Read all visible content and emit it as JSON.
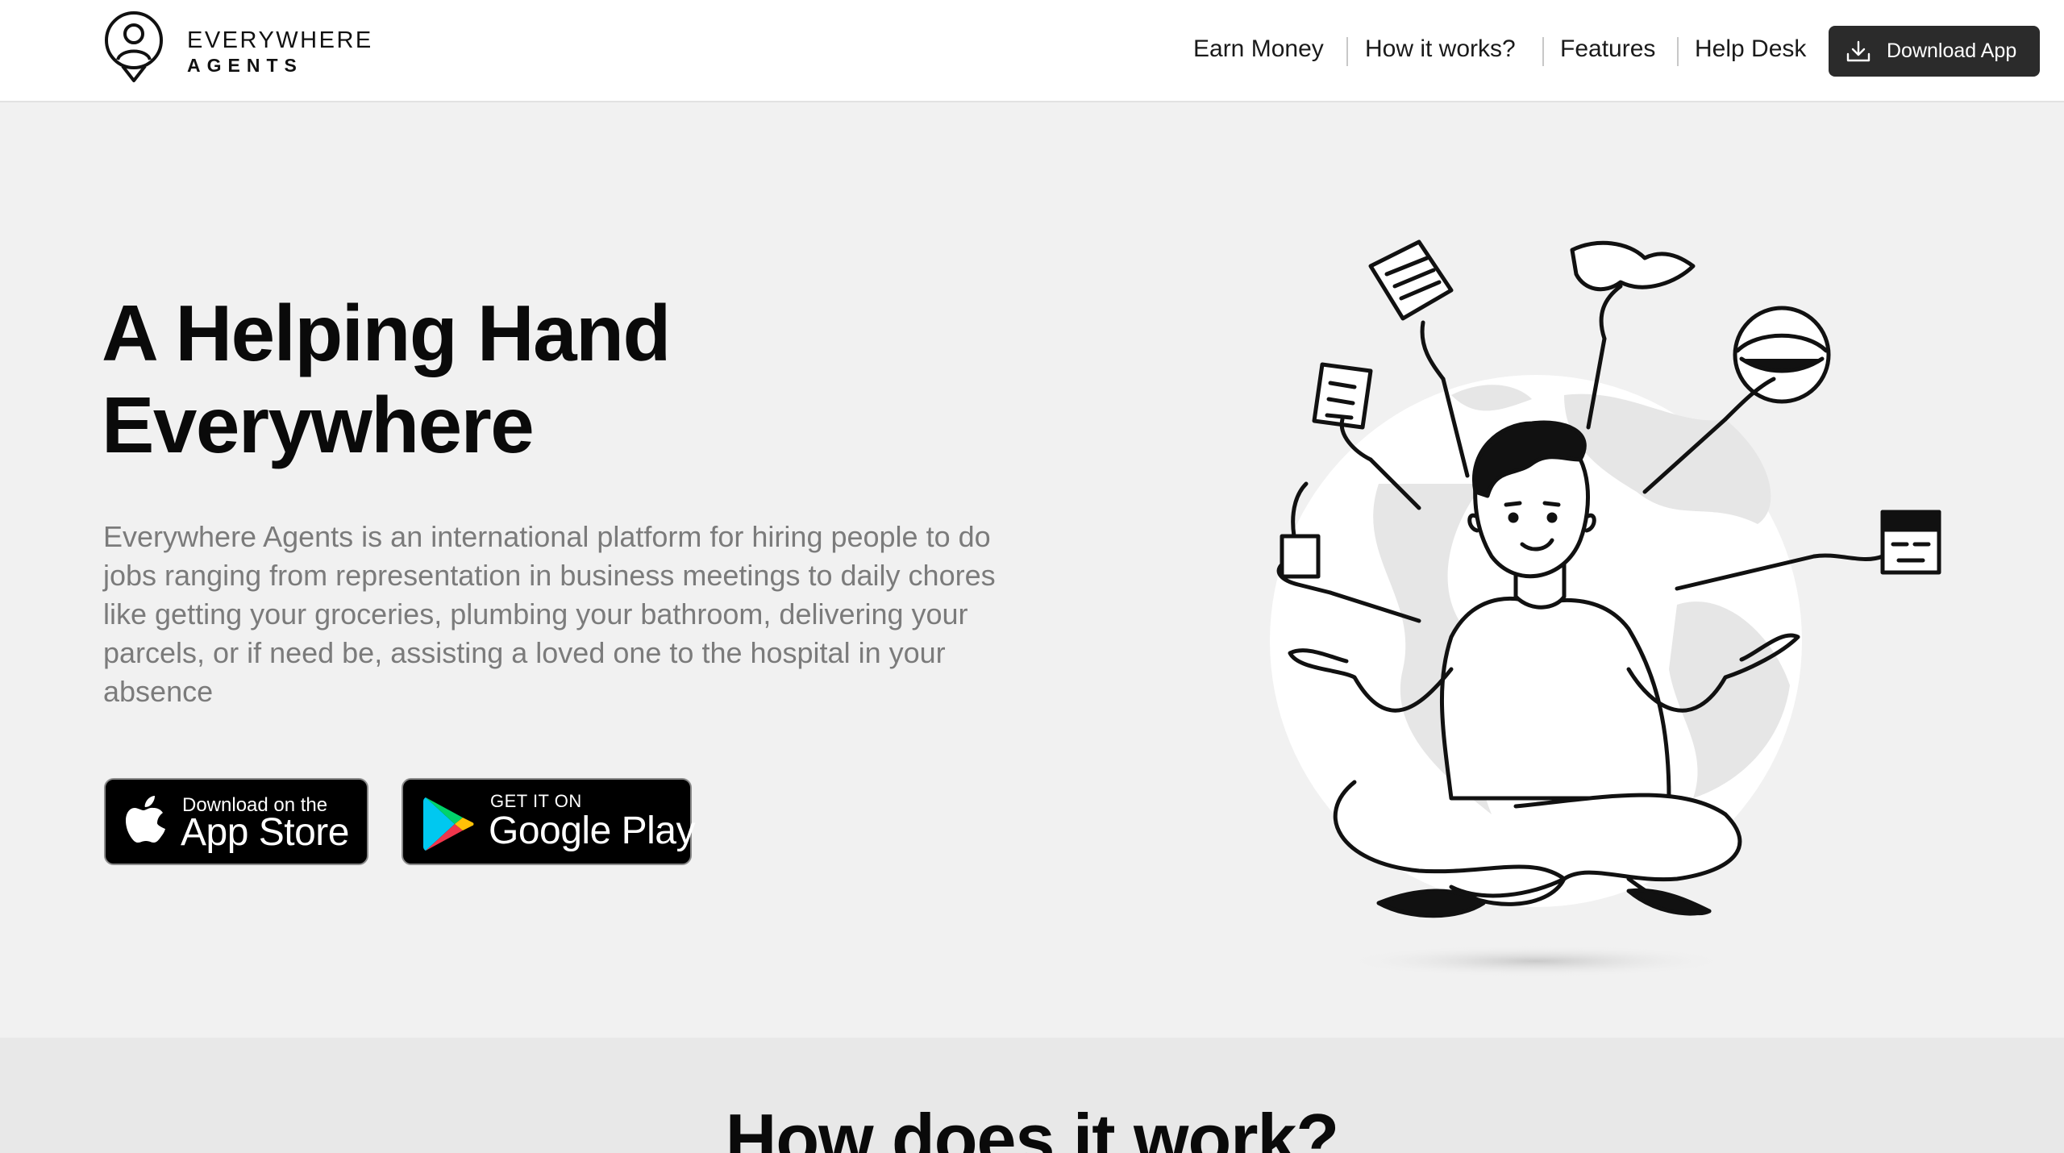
{
  "brand": {
    "name_line_1": "EVERYWHERE",
    "name_line_2": "AGENTS"
  },
  "nav": {
    "items": [
      {
        "label": "Earn Money"
      },
      {
        "label": "How it works?"
      },
      {
        "label": "Features"
      },
      {
        "label": "Help Desk"
      }
    ],
    "download_button": "Download App"
  },
  "hero": {
    "title_line_1": "A Helping Hand",
    "title_line_2": "Everywhere",
    "description": "Everywhere Agents is an international platform for hiring people to do jobs ranging from representation in business meetings to daily chores like getting your groceries, plumbing your bathroom, delivering your parcels, or if need be, assisting a loved one to the hospital in your absence"
  },
  "app_store": {
    "small": "Download on the",
    "big": "App Store"
  },
  "google_play": {
    "small": "GET IT ON",
    "big": "Google Play"
  },
  "section_2": {
    "title": "How does it work?"
  },
  "colors": {
    "page_bg": "#f1f1f1",
    "header_bg": "#ffffff",
    "button_dark": "#2b2b2b",
    "description_text": "#7b7b7b"
  },
  "icons": {
    "logo": "location-pin-person-icon",
    "download": "download-tray-icon",
    "apple": "apple-logo-icon",
    "google_play": "google-play-triangle-icon"
  }
}
